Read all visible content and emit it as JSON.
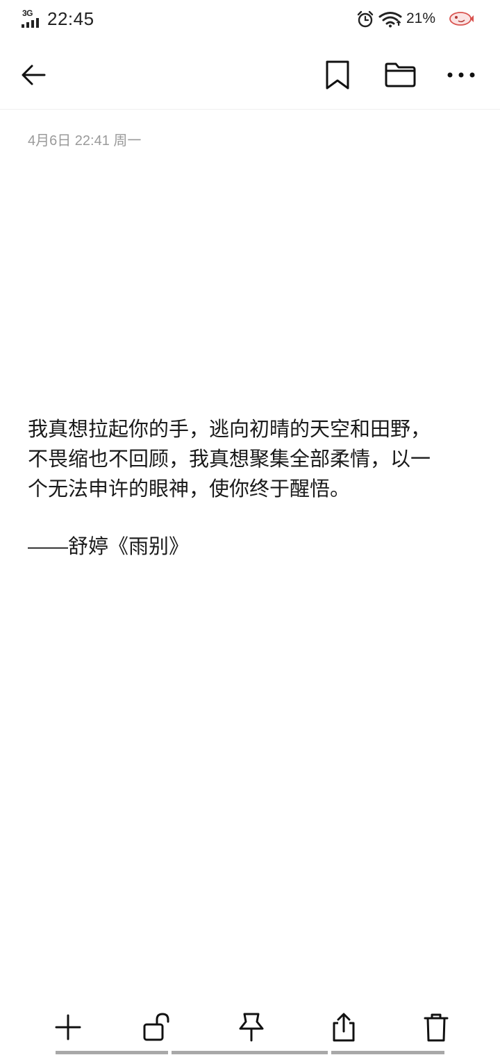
{
  "status_bar": {
    "network_type": "3G",
    "time": "22:45",
    "battery_percent": "21%",
    "icons": [
      "signal-icon",
      "alarm-icon",
      "wifi-icon",
      "notification-app-icon"
    ]
  },
  "toolbar": {
    "icons": [
      "back-arrow-icon",
      "bookmark-icon",
      "folder-icon",
      "more-icon"
    ]
  },
  "note": {
    "meta": "4月6日 22:41 周一",
    "lines": [
      "我真想拉起你的手，逃向初晴的天空和田野，",
      "不畏缩也不回顾，我真想聚集全部柔情，以一",
      "个无法申许的眼神，使你终于醒悟。"
    ],
    "attribution": "——舒婷《雨别》"
  },
  "bottom_bar": {
    "icons": [
      "add-icon",
      "unlock-icon",
      "pin-icon",
      "share-icon",
      "trash-icon"
    ]
  },
  "colors": {
    "background": "#ffffff",
    "text": "#1a1a1a",
    "meta_text": "#9a9a9a",
    "nav_indicator": "#a8a8a8"
  }
}
